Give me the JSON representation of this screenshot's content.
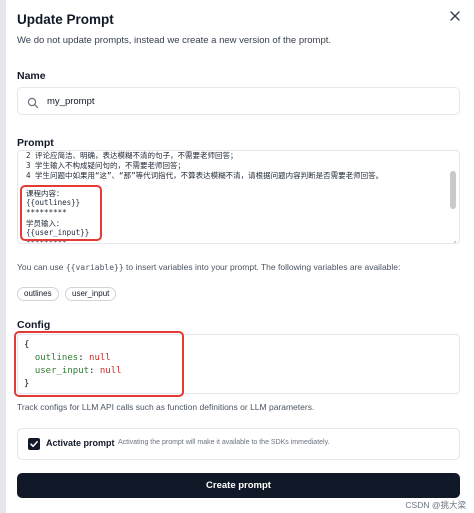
{
  "dialog": {
    "title": "Update Prompt",
    "description": "We do not update prompts, instead we create a new version of the prompt.",
    "close_icon": "close-icon"
  },
  "name_section": {
    "label": "Name",
    "value": "my_prompt",
    "icon": "search-icon"
  },
  "prompt_section": {
    "label": "Prompt",
    "lines": [
      "2 评论应简洁、明确，表达模糊不清的句子，不需要老师回答；",
      "3 学生输入不构成疑问句的，不需要老师回答；",
      "4 学生问题中如果用“这”、“那”等代词指代，不算表达模糊不清，请根据问题内容判断是否需要老师回答。",
      "",
      "课程内容：",
      "{{outlines}}",
      "*********",
      "学员输入：",
      "{{user_input}}",
      "*********"
    ]
  },
  "variables": {
    "hint_prefix": "You can use",
    "hint_code": "{{variable}}",
    "hint_suffix": "to insert variables into your prompt. The following variables are available:",
    "items": [
      "outlines",
      "user_input"
    ]
  },
  "config_section": {
    "label": "Config",
    "open_brace": "{",
    "entries": [
      {
        "key": "outlines",
        "value": "null"
      },
      {
        "key": "user_input",
        "value": "null"
      }
    ],
    "close_brace": "}",
    "help_text": "Track configs for LLM API calls such as function definitions or LLM parameters."
  },
  "activate": {
    "checked": true,
    "label": "Activate prompt",
    "description": "Activating the prompt will make it available to the SDKs immediately."
  },
  "submit": {
    "label": "Create prompt"
  },
  "watermark": "CSDN @挑大梁",
  "colors": {
    "primary": "#111827",
    "highlight_border": "#e53935",
    "json_key": "#2e7d32",
    "json_null": "#c62828"
  }
}
